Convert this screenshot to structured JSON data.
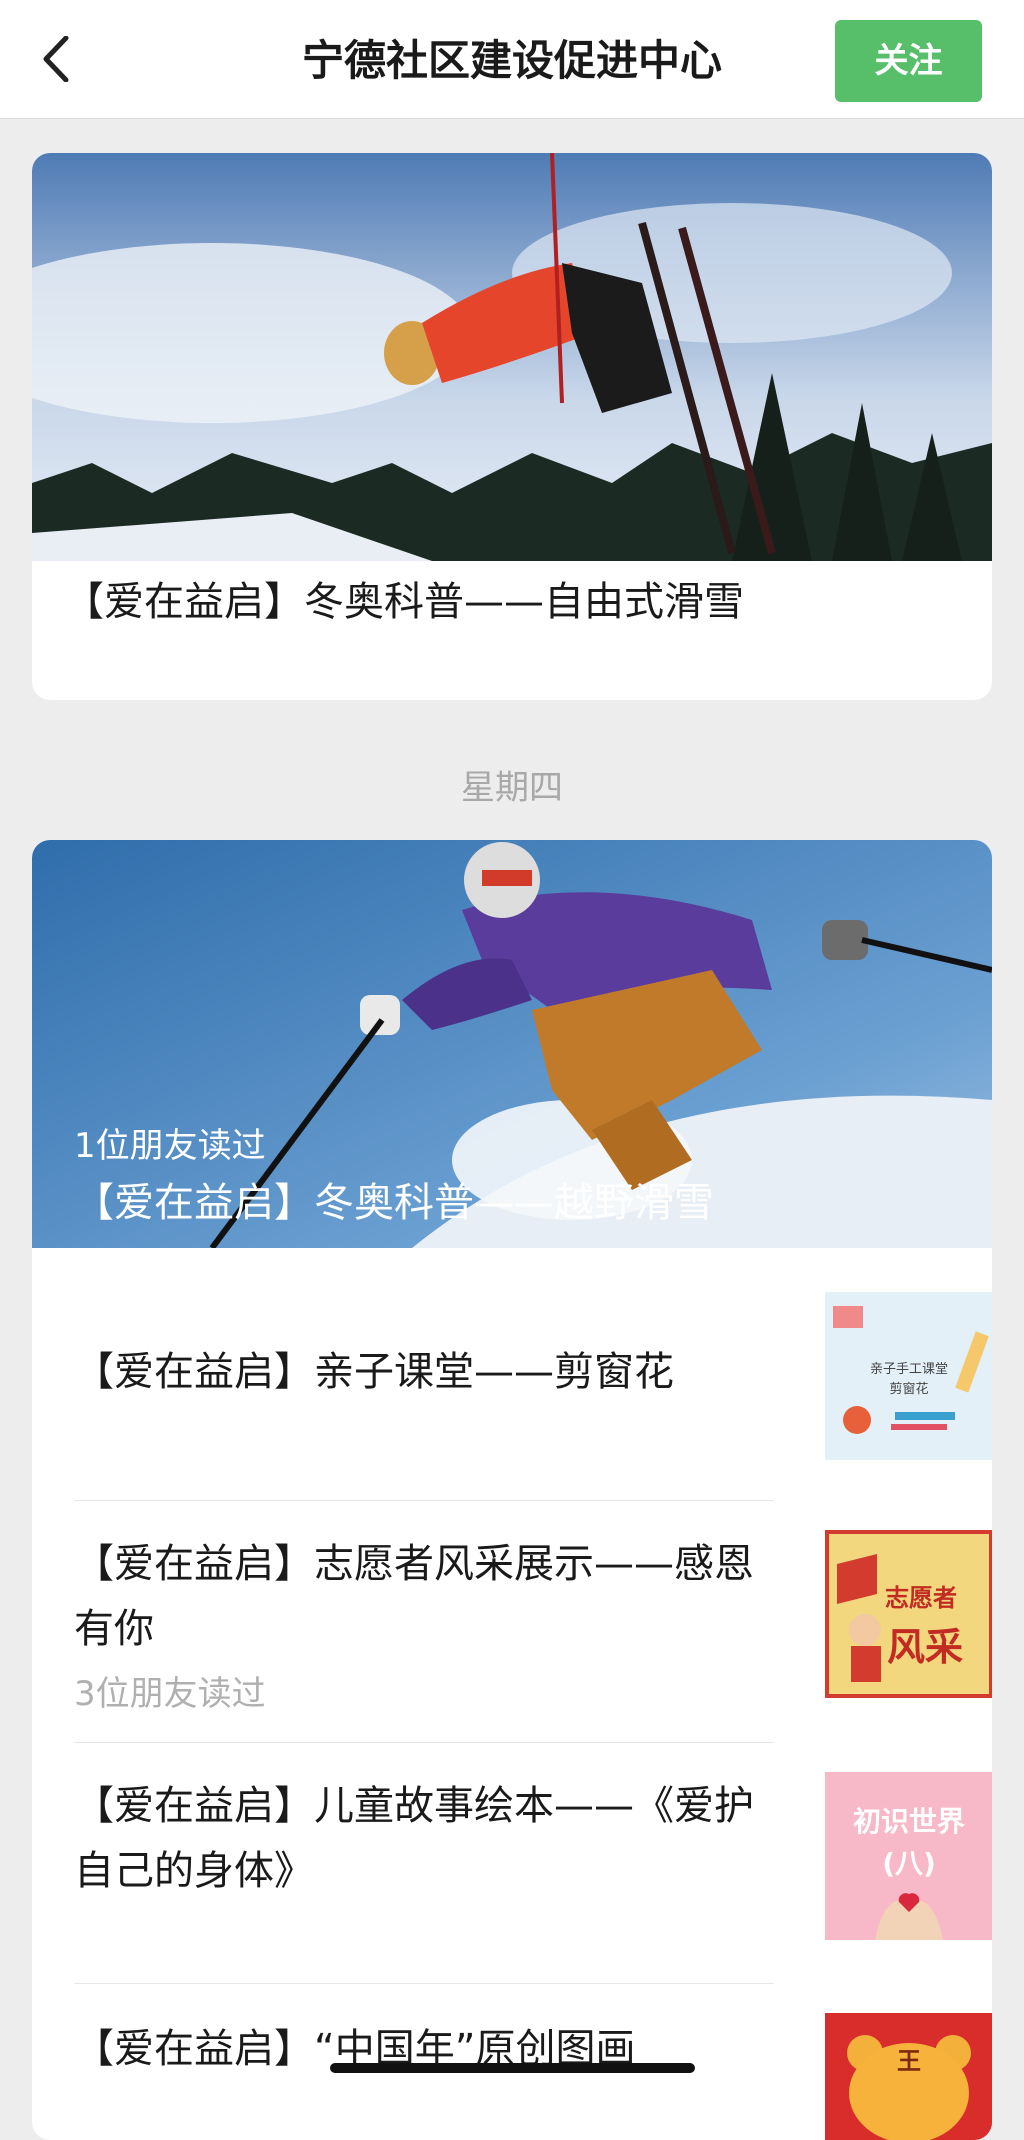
{
  "header": {
    "title": "宁德社区建设促进中心",
    "follow_label": "关注",
    "back_icon": "chevron-left-icon"
  },
  "articles": {
    "top": {
      "title": "【爱在益启】冬奥科普——自由式滑雪"
    },
    "day_label": "星期四",
    "feature": {
      "read_by": "1位朋友读过",
      "title": "【爱在益启】冬奥科普——越野滑雪"
    },
    "items": [
      {
        "title": "【爱在益启】亲子课堂——剪窗花",
        "read_by": "",
        "thumb_lines": [
          "亲子手工课堂",
          "剪窗花"
        ]
      },
      {
        "title": "【爱在益启】志愿者风采展示——感恩有你",
        "read_by": "3位朋友读过",
        "thumb_lines": [
          "志愿者",
          "风采"
        ]
      },
      {
        "title": "【爱在益启】儿童故事绘本——《爱护自己的身体》",
        "read_by": "",
        "thumb_lines": [
          "初识世界",
          "(八)"
        ]
      },
      {
        "title": "【爱在益启】“中国年”原创图画",
        "read_by": "",
        "thumb_lines": [
          "王"
        ]
      }
    ]
  },
  "colors": {
    "follow_bg": "#57be6a",
    "page_bg": "#ededed"
  }
}
